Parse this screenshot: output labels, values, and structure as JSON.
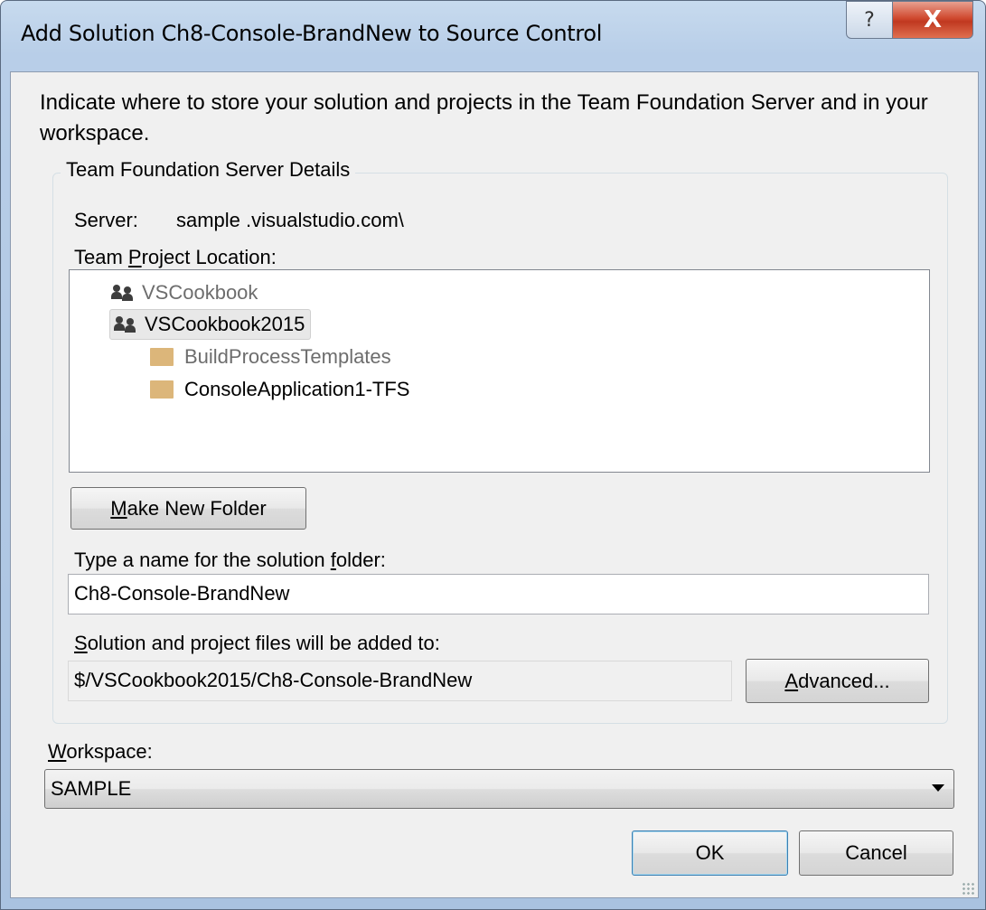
{
  "window": {
    "title": "Add Solution Ch8-Console-BrandNew to Source Control",
    "help_glyph": "?",
    "close_glyph": "X"
  },
  "intro": "Indicate where to store your solution and projects in the Team Foundation Server and in your workspace.",
  "group": {
    "legend": "Team Foundation Server Details",
    "server_label": "Server:",
    "server_value": "sample .visualstudio.com\\",
    "location_label_pre": "Team ",
    "location_label_accel": "P",
    "location_label_post": "roject Location:"
  },
  "tree": {
    "items": [
      {
        "label": "VSCookbook",
        "icon": "team-icon",
        "dimmed": true
      },
      {
        "label": "VSCookbook2015",
        "icon": "team-icon",
        "selected": true
      },
      {
        "label": "BuildProcessTemplates",
        "icon": "folder-icon",
        "dimmed": true
      },
      {
        "label": "ConsoleApplication1-TFS",
        "icon": "folder-icon"
      }
    ]
  },
  "buttons": {
    "make_folder_accel": "M",
    "make_folder_rest": "ake New Folder",
    "advanced_accel": "A",
    "advanced_rest": "dvanced...",
    "ok": "OK",
    "cancel": "Cancel"
  },
  "solution_folder": {
    "label_pre": "Type a name for the solution ",
    "label_accel": "f",
    "label_post": "older:",
    "value": "Ch8-Console-BrandNew"
  },
  "added_to": {
    "label_accel": "S",
    "label_rest": "olution and project files will be added to:",
    "value": "$/VSCookbook2015/Ch8-Console-BrandNew"
  },
  "workspace": {
    "label_accel": "W",
    "label_rest": "orkspace:",
    "selected": "SAMPLE"
  }
}
